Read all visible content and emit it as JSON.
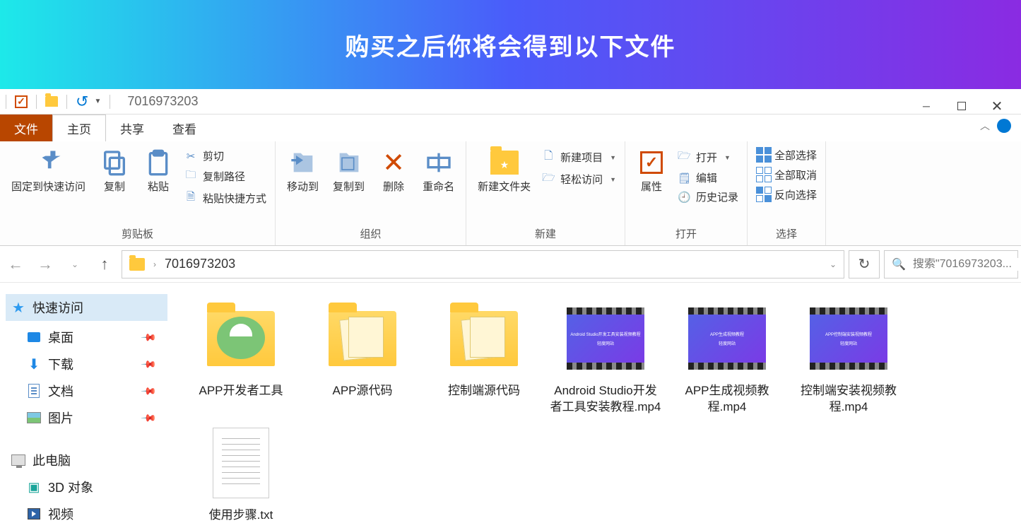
{
  "banner": {
    "title": "购买之后你将会得到以下文件"
  },
  "qat": {
    "folder_title": "7016973203"
  },
  "tabs": {
    "file": "文件",
    "home": "主页",
    "share": "共享",
    "view": "查看"
  },
  "ribbon": {
    "clipboard": {
      "label": "剪贴板",
      "pin": "固定到快速访问",
      "copy": "复制",
      "paste": "粘贴",
      "cut": "剪切",
      "copy_path": "复制路径",
      "paste_shortcut": "粘贴快捷方式"
    },
    "organize": {
      "label": "组织",
      "move_to": "移动到",
      "copy_to": "复制到",
      "delete": "删除",
      "rename": "重命名"
    },
    "new": {
      "label": "新建",
      "new_folder": "新建文件夹",
      "new_item": "新建项目",
      "easy_access": "轻松访问"
    },
    "open": {
      "label": "打开",
      "properties": "属性",
      "open": "打开",
      "edit": "编辑",
      "history": "历史记录"
    },
    "select": {
      "label": "选择",
      "select_all": "全部选择",
      "deselect_all": "全部取消",
      "invert": "反向选择"
    }
  },
  "nav": {
    "path": "7016973203",
    "search_placeholder": "搜索\"7016973203..."
  },
  "sidebar": {
    "quick_access": "快速访问",
    "desktop": "桌面",
    "downloads": "下载",
    "documents": "文档",
    "pictures": "图片",
    "this_pc": "此电脑",
    "three_d": "3D 对象",
    "video": "视频"
  },
  "files": [
    {
      "name": "APP开发者工具",
      "type": "folder-android"
    },
    {
      "name": "APP源代码",
      "type": "folder-multi"
    },
    {
      "name": "控制端源代码",
      "type": "folder-multi"
    },
    {
      "name": "Android Studio开发者工具安装教程.mp4",
      "type": "video"
    },
    {
      "name": "APP生成视频教程.mp4",
      "type": "video"
    },
    {
      "name": "控制端安装视频教程.mp4",
      "type": "video"
    },
    {
      "name": "使用步骤.txt",
      "type": "txt"
    }
  ]
}
